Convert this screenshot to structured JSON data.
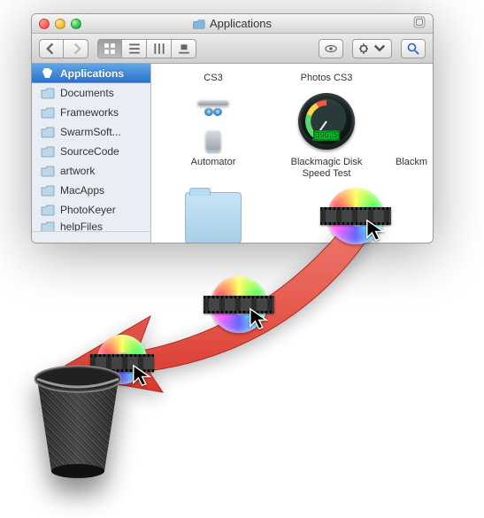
{
  "window": {
    "title": "Applications"
  },
  "sidebar": {
    "items": [
      {
        "label": "Applications",
        "icon": "apps",
        "selected": true
      },
      {
        "label": "Documents",
        "icon": "folder"
      },
      {
        "label": "Frameworks",
        "icon": "folder"
      },
      {
        "label": "SwarmSoft...",
        "icon": "folder"
      },
      {
        "label": "SourceCode",
        "icon": "folder"
      },
      {
        "label": "artwork",
        "icon": "folder"
      },
      {
        "label": "MacApps",
        "icon": "folder"
      },
      {
        "label": "PhotoKeyer",
        "icon": "folder"
      },
      {
        "label": "helpFiles",
        "icon": "folder"
      }
    ]
  },
  "content": {
    "row1": [
      {
        "label": "CS3"
      },
      {
        "label": "Photos CS3"
      }
    ],
    "row2": [
      {
        "label": "Automator",
        "icon": "automator"
      },
      {
        "label": "Blackmagic Disk\nSpeed Test",
        "icon": "gauge",
        "lcd": "396.5"
      },
      {
        "label": "Blackm",
        "icon": "cut"
      }
    ],
    "row3": [
      {
        "label": "",
        "icon": "folder"
      },
      {
        "label": "",
        "icon": "disc"
      }
    ]
  }
}
